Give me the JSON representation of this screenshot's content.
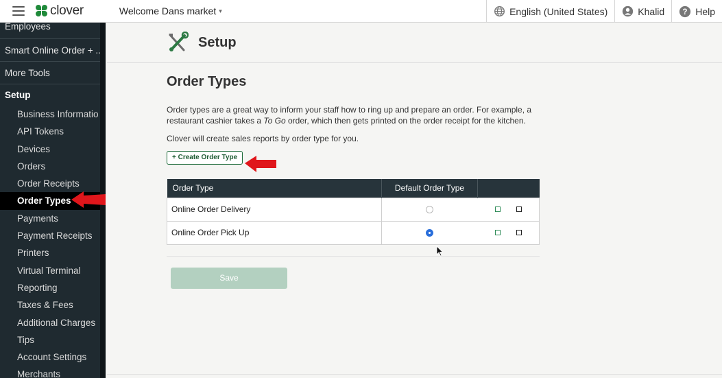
{
  "topbar": {
    "logo_text": "clover",
    "welcome": "Welcome Dans market",
    "language": "English (United States)",
    "user": "Khalid",
    "help": "Help"
  },
  "sidebar": {
    "items_top": [
      "Employees",
      "Smart Online Order + ...",
      "More Tools"
    ],
    "section": "Setup",
    "sub_items": [
      "Business Informatio",
      "API Tokens",
      "Devices",
      "Orders",
      "Order Receipts",
      "Order Types",
      "Payments",
      "Payment Receipts",
      "Printers",
      "Virtual Terminal",
      "Reporting",
      "Taxes & Fees",
      "Additional Charges",
      "Tips",
      "Account Settings",
      "Merchants"
    ],
    "active": "Order Types"
  },
  "page": {
    "title": "Setup",
    "heading": "Order Types",
    "description_part1": "Order types are a great way to inform your staff how to ring up and prepare an order. For example, a restaurant cashier takes a ",
    "description_em": "To Go",
    "description_part2": " order, which then gets printed on the order receipt for the kitchen.",
    "description2": "Clover will create sales reports by order type for you.",
    "create_button": "+ Create Order Type",
    "save_button": "Save"
  },
  "table": {
    "headers": [
      "Order Type",
      "Default Order Type",
      ""
    ],
    "rows": [
      {
        "name": "Online Order Delivery",
        "default": false
      },
      {
        "name": "Online Order Pick Up",
        "default": true
      }
    ]
  },
  "colors": {
    "sidebar_bg": "#1f2a30",
    "accent_green": "#1e6b3a",
    "annotation_red": "#e0161b",
    "radio_selected": "#2a6fdb"
  }
}
